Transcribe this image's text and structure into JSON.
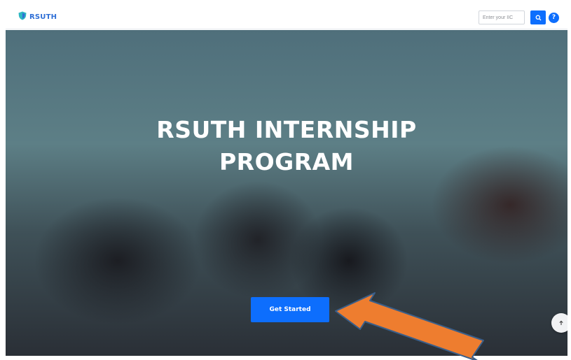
{
  "brand": {
    "name": "RSUTH",
    "logo_icon": "shield-icon"
  },
  "search": {
    "placeholder": "Enter your IIC",
    "search_icon": "search-icon",
    "help_label": "?"
  },
  "hero": {
    "title_line1": "RSUTH INTERNSHIP",
    "title_line2": "PROGRAM",
    "cta_label": "Get Started",
    "scroll_top_icon": "arrow-up-icon"
  },
  "annotation": {
    "icon": "pointer-arrow-icon",
    "color": "#ee7d2f"
  },
  "colors": {
    "accent": "#0d6efd",
    "brand_text": "#2f6fd6"
  }
}
